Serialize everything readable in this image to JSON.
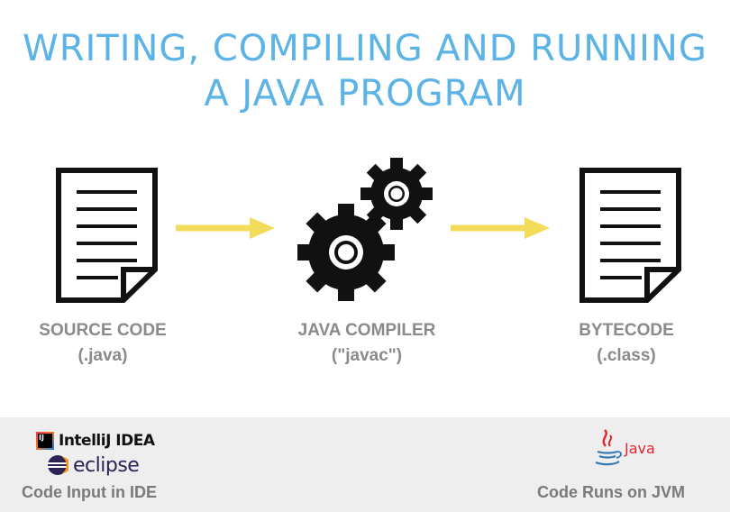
{
  "title": {
    "line1": "WRITING, COMPILING AND RUNNING",
    "line2": "A JAVA PROGRAM"
  },
  "nodes": [
    {
      "name": "SOURCE CODE",
      "detail": "(.java)"
    },
    {
      "name": "JAVA COMPILER",
      "detail": "(\"javac\")"
    },
    {
      "name": "BYTECODE",
      "detail": "(.class)"
    }
  ],
  "footer": {
    "left_caption": "Code Input in IDE",
    "right_caption": "Code Runs on JVM",
    "logos": {
      "intellij_badge": "IJ",
      "intellij": "IntelliJ IDEA",
      "eclipse": "eclipse",
      "java": "Java"
    }
  },
  "colors": {
    "title": "#5bb3e6",
    "arrow": "#f3dc5a",
    "label": "#8a8a8a",
    "footer_bg": "#eeeeee",
    "footer_text": "#7a7a7a",
    "java_red": "#e3262b",
    "java_blue": "#2f79b5",
    "eclipse_purple": "#2c2255"
  }
}
